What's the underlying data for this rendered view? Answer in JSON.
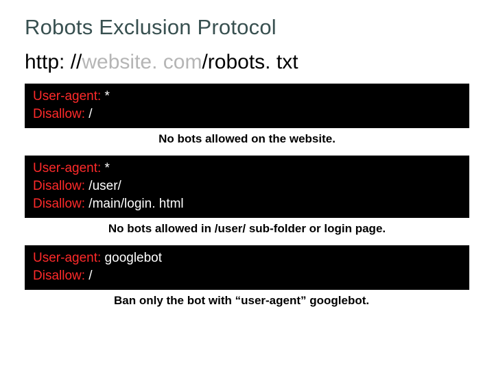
{
  "title": "Robots Exclusion Protocol",
  "url": {
    "p1": "http: //",
    "p2": "website. com",
    "p3": "/robots. txt"
  },
  "blocks": [
    {
      "lines": [
        {
          "key": "User-agent:",
          "val": " *"
        },
        {
          "key": "Disallow:",
          "val": " /"
        }
      ],
      "caption": "No bots allowed on the website."
    },
    {
      "lines": [
        {
          "key": "User-agent:",
          "val": " *"
        },
        {
          "key": "Disallow:",
          "val": " /user/"
        },
        {
          "key": "Disallow:",
          "val": " /main/login. html"
        }
      ],
      "caption": "No bots allowed in /user/ sub-folder or login page."
    },
    {
      "lines": [
        {
          "key": "User-agent:",
          "val": " googlebot"
        },
        {
          "key": "Disallow:",
          "val": " /"
        }
      ],
      "caption": "Ban only the bot with “user-agent” googlebot."
    }
  ]
}
